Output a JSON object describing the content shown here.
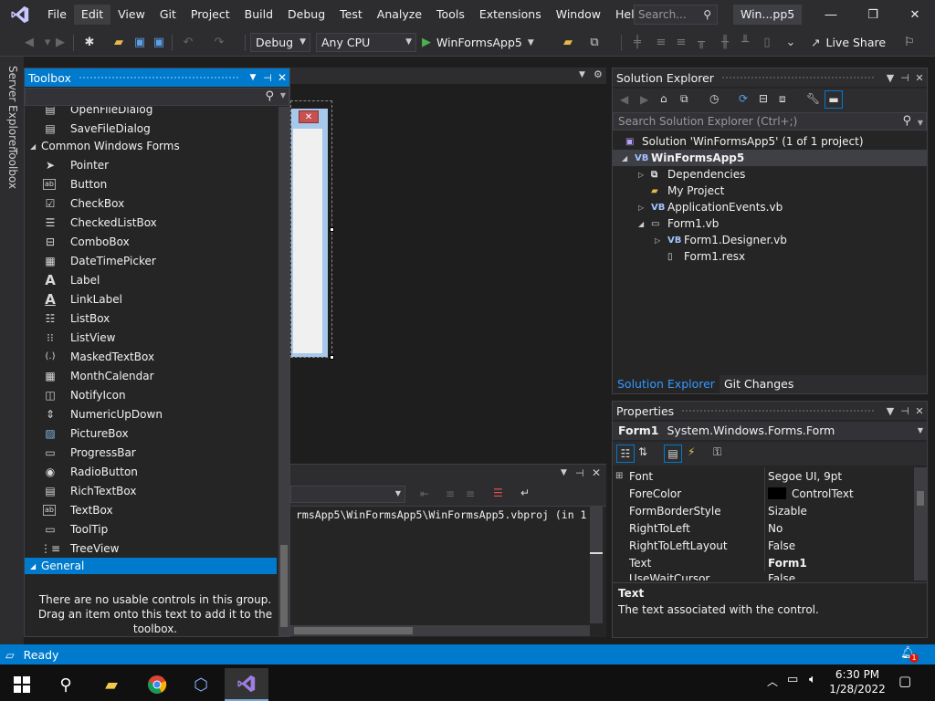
{
  "menubar": {
    "items": [
      "File",
      "Edit",
      "View",
      "Git",
      "Project",
      "Build",
      "Debug",
      "Test",
      "Analyze",
      "Tools",
      "Extensions",
      "Window",
      "Help"
    ],
    "active": "Edit",
    "search_placeholder": "Search...",
    "window_title": "Win...pp5"
  },
  "toolbar": {
    "config": "Debug",
    "platform": "Any CPU",
    "run_target": "WinFormsApp5",
    "live_share": "Live Share"
  },
  "left_tabs": [
    "Server Explorer",
    "Toolbox"
  ],
  "toolbox": {
    "title": "Toolbox",
    "items_top": [
      "OpenFileDialog",
      "SaveFileDialog"
    ],
    "group_common": "Common Windows Forms",
    "common_items": [
      {
        "label": "Pointer",
        "icon": "pointer-icon"
      },
      {
        "label": "Button",
        "icon": "button-icon"
      },
      {
        "label": "CheckBox",
        "icon": "checkbox-icon"
      },
      {
        "label": "CheckedListBox",
        "icon": "checkedlistbox-icon"
      },
      {
        "label": "ComboBox",
        "icon": "combobox-icon"
      },
      {
        "label": "DateTimePicker",
        "icon": "datetimepicker-icon"
      },
      {
        "label": "Label",
        "icon": "label-icon"
      },
      {
        "label": "LinkLabel",
        "icon": "linklabel-icon"
      },
      {
        "label": "ListBox",
        "icon": "listbox-icon"
      },
      {
        "label": "ListView",
        "icon": "listview-icon"
      },
      {
        "label": "MaskedTextBox",
        "icon": "maskedtextbox-icon"
      },
      {
        "label": "MonthCalendar",
        "icon": "monthcalendar-icon"
      },
      {
        "label": "NotifyIcon",
        "icon": "notifyicon-icon"
      },
      {
        "label": "NumericUpDown",
        "icon": "numericupdown-icon"
      },
      {
        "label": "PictureBox",
        "icon": "picturebox-icon"
      },
      {
        "label": "ProgressBar",
        "icon": "progressbar-icon"
      },
      {
        "label": "RadioButton",
        "icon": "radiobutton-icon"
      },
      {
        "label": "RichTextBox",
        "icon": "richtextbox-icon"
      },
      {
        "label": "TextBox",
        "icon": "textbox-icon"
      },
      {
        "label": "ToolTip",
        "icon": "tooltip-icon"
      },
      {
        "label": "TreeView",
        "icon": "treeview-icon"
      }
    ],
    "group_general": "General",
    "empty_text": "There are no usable controls in this group. Drag an item onto this text to add it to the toolbox."
  },
  "output": {
    "text": "rmsApp5\\WinFormsApp5\\WinFormsApp5.vbproj (in 1"
  },
  "solution_explorer": {
    "title": "Solution Explorer",
    "search_placeholder": "Search Solution Explorer (Ctrl+;)",
    "solution": "Solution 'WinFormsApp5' (1 of 1 project)",
    "project": "WinFormsApp5",
    "nodes": {
      "dependencies": "Dependencies",
      "my_project": "My Project",
      "app_events": "ApplicationEvents.vb",
      "form1": "Form1.vb",
      "form1_designer": "Form1.Designer.vb",
      "form1_resx": "Form1.resx"
    },
    "tabs": [
      "Solution Explorer",
      "Git Changes"
    ]
  },
  "properties": {
    "title": "Properties",
    "object_name": "Form1",
    "object_type": "System.Windows.Forms.Form",
    "rows": [
      {
        "name": "Font",
        "value": "Segoe UI, 9pt"
      },
      {
        "name": "ForeColor",
        "value": "ControlText"
      },
      {
        "name": "FormBorderStyle",
        "value": "Sizable"
      },
      {
        "name": "RightToLeft",
        "value": "No"
      },
      {
        "name": "RightToLeftLayout",
        "value": "False"
      },
      {
        "name": "Text",
        "value": "Form1"
      },
      {
        "name": "UseWaitCursor",
        "value": "False"
      }
    ],
    "desc_title": "Text",
    "desc_text": "The text associated with the control."
  },
  "status": {
    "text": "Ready",
    "notifications": "1"
  },
  "taskbar": {
    "time": "6:30 PM",
    "date": "1/28/2022"
  },
  "colors": {
    "accent": "#007acc",
    "background": "#1e1e1e",
    "panel": "#252526",
    "chrome": "#2d2d30"
  }
}
